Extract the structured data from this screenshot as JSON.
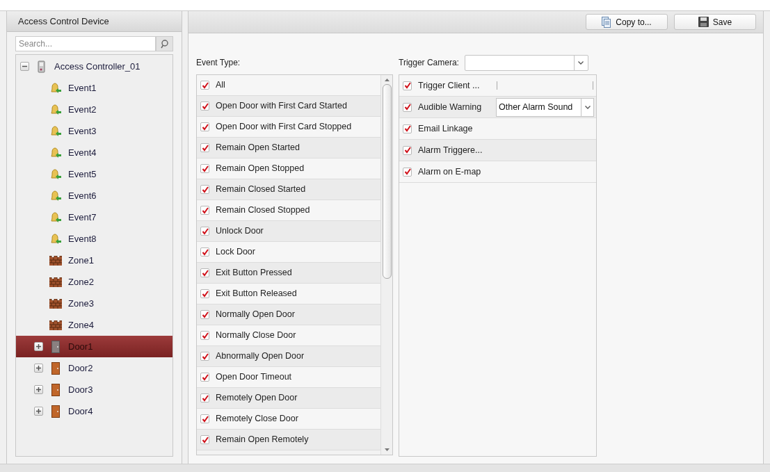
{
  "device_panel": {
    "title": "Access Control Device",
    "search": {
      "placeholder": "Search..."
    },
    "tree": [
      {
        "label": "Access Controller_01",
        "kind": "controller",
        "expanded": true,
        "selected": false,
        "children": [
          {
            "label": "Event1",
            "kind": "event",
            "selected": false
          },
          {
            "label": "Event2",
            "kind": "event",
            "selected": false
          },
          {
            "label": "Event3",
            "kind": "event",
            "selected": false
          },
          {
            "label": "Event4",
            "kind": "event",
            "selected": false
          },
          {
            "label": "Event5",
            "kind": "event",
            "selected": false
          },
          {
            "label": "Event6",
            "kind": "event",
            "selected": false
          },
          {
            "label": "Event7",
            "kind": "event",
            "selected": false
          },
          {
            "label": "Event8",
            "kind": "event",
            "selected": false
          },
          {
            "label": "Zone1",
            "kind": "zone",
            "selected": false
          },
          {
            "label": "Zone2",
            "kind": "zone",
            "selected": false
          },
          {
            "label": "Zone3",
            "kind": "zone",
            "selected": false
          },
          {
            "label": "Zone4",
            "kind": "zone",
            "selected": false
          },
          {
            "label": "Door1",
            "kind": "door",
            "expanded": false,
            "selected": true
          },
          {
            "label": "Door2",
            "kind": "door",
            "expanded": false,
            "selected": false
          },
          {
            "label": "Door3",
            "kind": "door",
            "expanded": false,
            "selected": false
          },
          {
            "label": "Door4",
            "kind": "door",
            "expanded": false,
            "selected": false
          }
        ]
      }
    ]
  },
  "toolbar": {
    "buttons": [
      {
        "label": "Copy to...",
        "kind": "copy"
      },
      {
        "label": "Save",
        "kind": "save"
      }
    ]
  },
  "event_type": {
    "label": "Event Type:",
    "items": [
      {
        "label": "All",
        "checked": true
      },
      {
        "label": "Open Door with First Card Started",
        "checked": true
      },
      {
        "label": "Open Door with First Card Stopped",
        "checked": true
      },
      {
        "label": "Remain Open Started",
        "checked": true
      },
      {
        "label": "Remain Open Stopped",
        "checked": true
      },
      {
        "label": "Remain Closed Started",
        "checked": true
      },
      {
        "label": "Remain Closed Stopped",
        "checked": true
      },
      {
        "label": "Unlock Door",
        "checked": true
      },
      {
        "label": "Lock Door",
        "checked": true
      },
      {
        "label": "Exit Button Pressed",
        "checked": true
      },
      {
        "label": "Exit Button Released",
        "checked": true
      },
      {
        "label": "Normally Open Door",
        "checked": true
      },
      {
        "label": "Normally Close Door",
        "checked": true
      },
      {
        "label": "Abnormally Open Door",
        "checked": true
      },
      {
        "label": "Open Door Timeout",
        "checked": true
      },
      {
        "label": "Remotely Open Door",
        "checked": true
      },
      {
        "label": "Remotely Close Door",
        "checked": true
      },
      {
        "label": "Remain Open Remotely",
        "checked": true
      }
    ]
  },
  "trigger_camera": {
    "label": "Trigger Camera:"
  },
  "actions": [
    {
      "label": "Trigger Client ...",
      "checked": true,
      "kind": "divider"
    },
    {
      "label": "Audible Warning",
      "checked": true,
      "kind": "select",
      "value": "Other Alarm Sound"
    },
    {
      "label": "Email Linkage",
      "checked": true,
      "kind": "plain"
    },
    {
      "label": "Alarm Triggere...",
      "checked": true,
      "kind": "plain"
    },
    {
      "label": "Alarm on E-map",
      "checked": true,
      "kind": "plain"
    }
  ]
}
